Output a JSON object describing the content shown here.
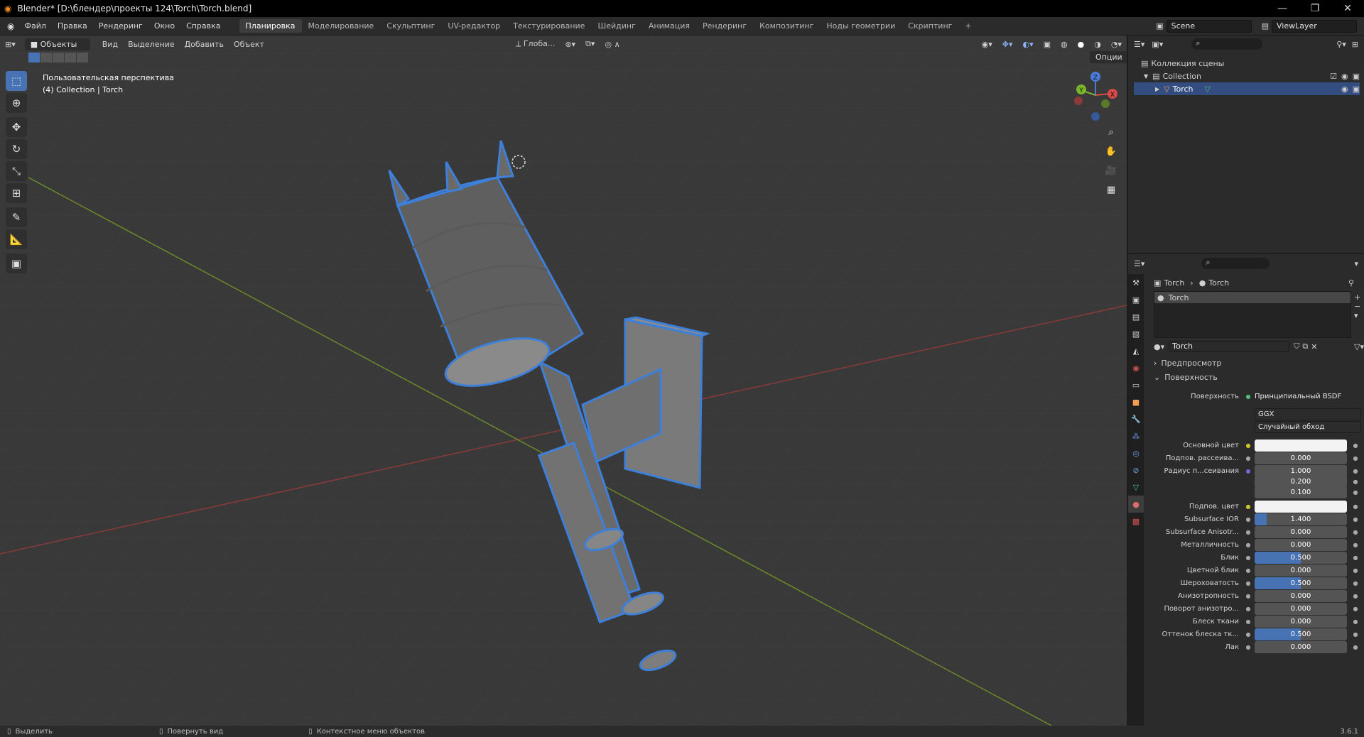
{
  "window": {
    "title": "Blender* [D:\\блендер\\проекты 124\\Torch\\Torch.blend]",
    "minimize": "—",
    "maximize": "❐",
    "close": "✕"
  },
  "menu": [
    "Файл",
    "Правка",
    "Рендеринг",
    "Окно",
    "Справка"
  ],
  "workspaces": [
    "Планировка",
    "Моделирование",
    "Скульптинг",
    "UV-редактор",
    "Текстурирование",
    "Шейдинг",
    "Анимация",
    "Рендеринг",
    "Композитинг",
    "Ноды геометрии",
    "Скриптинг"
  ],
  "workspace_add": "+",
  "scene": "Scene",
  "view_layer": "ViewLayer",
  "viewport": {
    "mode": "Объекты",
    "header_menu": [
      "Вид",
      "Выделение",
      "Добавить",
      "Объект"
    ],
    "transform_orientation": "Глоба...",
    "options": "Опции",
    "overlay_title": "Пользовательская перспектива",
    "overlay_sub": "(4) Collection | Torch",
    "gizmo_labels": {
      "x": "X",
      "y": "Y",
      "z": "Z"
    }
  },
  "outliner": {
    "scene_collection": "Коллекция сцены",
    "items": [
      {
        "name": "Collection"
      },
      {
        "name": "Torch"
      }
    ]
  },
  "properties": {
    "breadcrumb": [
      "Torch",
      "Torch"
    ],
    "material_slot": "Torch",
    "material_name": "Torch",
    "sections": {
      "preview": "Предпросмотр",
      "surface": "Поверхность"
    },
    "surface_label": "Поверхность",
    "surface_shader": "Принципиальный BSDF",
    "distribution": "GGX",
    "subsurface_method": "Случайный обход",
    "rows": [
      {
        "label": "Основной цвет",
        "value": "",
        "type": "color",
        "dot": "#c7c72a"
      },
      {
        "label": "Подпов. рассеива...",
        "value": "0.000",
        "fill": 0,
        "dot": "#a6a6a6"
      },
      {
        "label": "Радиус п...сеивания",
        "value": "1.000",
        "fill": 0,
        "dot": "#6b6bd6"
      },
      {
        "label": "",
        "value": "0.200",
        "fill": 0,
        "dot": ""
      },
      {
        "label": "",
        "value": "0.100",
        "fill": 0,
        "dot": ""
      },
      {
        "label": "Подпов. цвет",
        "value": "",
        "type": "color",
        "dot": "#c7c72a"
      },
      {
        "label": "Subsurface IOR",
        "value": "1.400",
        "fill": 0.13,
        "dot": "#a6a6a6"
      },
      {
        "label": "Subsurface Anisotr...",
        "value": "0.000",
        "fill": 0,
        "dot": "#a6a6a6"
      },
      {
        "label": "Металличность",
        "value": "0.000",
        "fill": 0,
        "dot": "#a6a6a6"
      },
      {
        "label": "Блик",
        "value": "0.500",
        "fill": 0.5,
        "dot": "#a6a6a6"
      },
      {
        "label": "Цветной блик",
        "value": "0.000",
        "fill": 0,
        "dot": "#a6a6a6"
      },
      {
        "label": "Шероховатость",
        "value": "0.500",
        "fill": 0.5,
        "dot": "#a6a6a6"
      },
      {
        "label": "Анизотропность",
        "value": "0.000",
        "fill": 0,
        "dot": "#a6a6a6"
      },
      {
        "label": "Поворот анизотро...",
        "value": "0.000",
        "fill": 0,
        "dot": "#a6a6a6"
      },
      {
        "label": "Блеск ткани",
        "value": "0.000",
        "fill": 0,
        "dot": "#a6a6a6"
      },
      {
        "label": "Оттенок блеска тк...",
        "value": "0.500",
        "fill": 0.5,
        "dot": "#a6a6a6"
      },
      {
        "label": "Лак",
        "value": "0.000",
        "fill": 0,
        "dot": "#a6a6a6"
      }
    ]
  },
  "status": {
    "select": "Выделить",
    "rotate": "Повернуть вид",
    "context": "Контекстное меню объектов",
    "version": "3.6.1"
  },
  "colors": {
    "accent": "#4772b3",
    "selection_outline": "#3d7fd9"
  }
}
